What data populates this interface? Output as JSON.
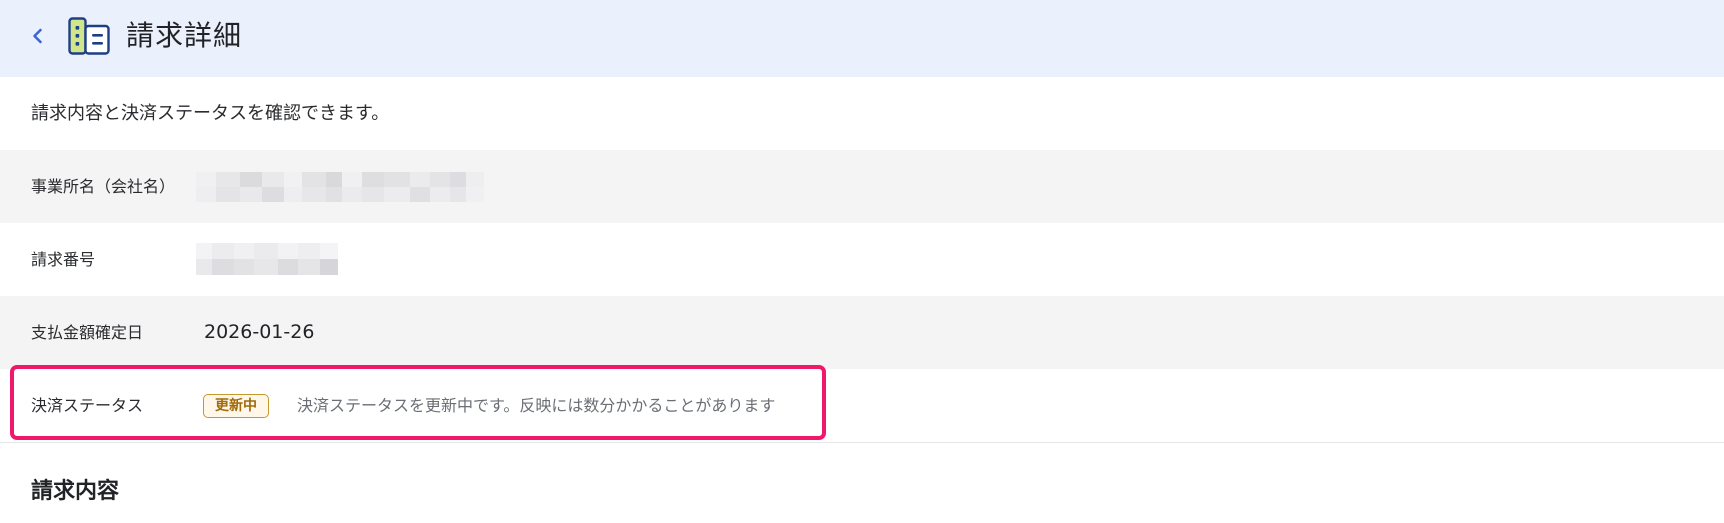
{
  "header": {
    "title": "請求詳細",
    "back_icon": "chevron-left-icon",
    "app_icon": "building-icon",
    "accent_color": "#3f64d6",
    "background_color": "#eaf1fd"
  },
  "intro": "請求内容と決済ステータスを確認できます。",
  "details": {
    "company_name": {
      "label": "事業所名（会社名）",
      "value_state": "blurred"
    },
    "invoice_number": {
      "label": "請求番号",
      "value_state": "blurred"
    },
    "payment_confirmed_date": {
      "label": "支払金額確定日",
      "value": "2026-01-26"
    },
    "payment_status": {
      "label": "決済ステータス",
      "badge": "更新中",
      "badge_color": "#c7972c",
      "message": "決済ステータスを更新中です。反映には数分かかることがあります"
    }
  },
  "highlight_color": "#f0186a",
  "section": {
    "heading": "請求内容"
  }
}
